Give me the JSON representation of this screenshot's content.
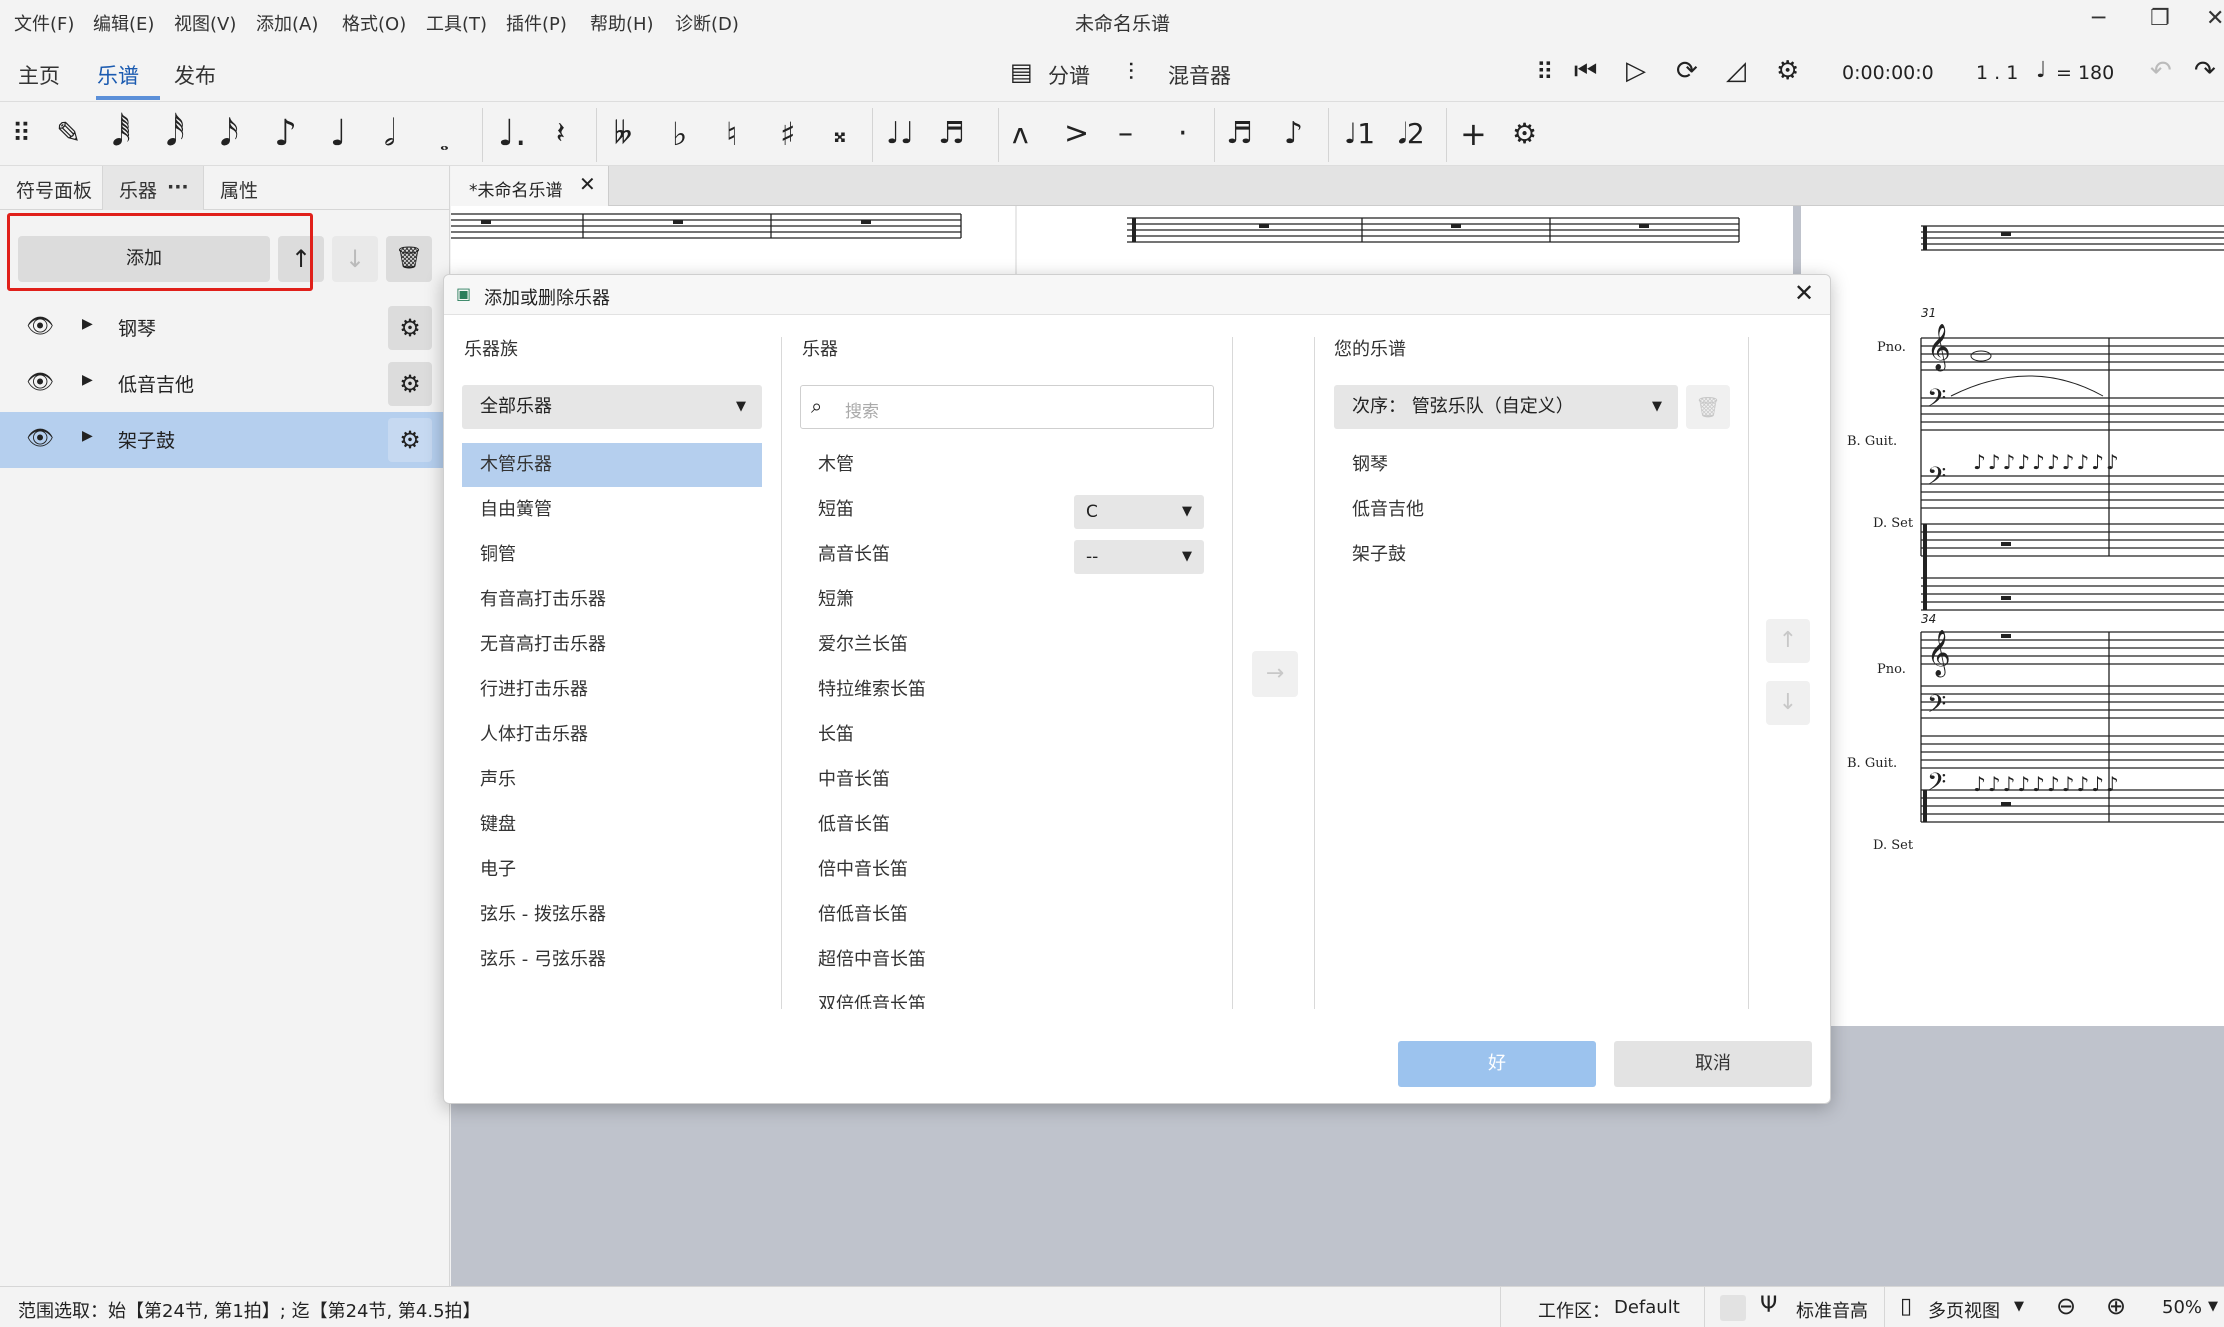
{
  "menubar": {
    "items": [
      "文件(F)",
      "编辑(E)",
      "视图(V)",
      "添加(A)",
      "格式(O)",
      "工具(T)",
      "插件(P)",
      "帮助(H)",
      "诊断(D)"
    ],
    "title": "未命名乐谱"
  },
  "nav": {
    "tabs": [
      "主页",
      "乐谱",
      "发布"
    ],
    "parts_label": "分谱",
    "mixer_label": "混音器",
    "time": "0:00:00:0",
    "position": "1 . 1",
    "tempo": "= 180"
  },
  "left_panel": {
    "tabs": [
      "符号面板",
      "乐器",
      "属性"
    ],
    "more": "···",
    "add_label": "添加",
    "instruments": [
      "钢琴",
      "低音吉他",
      "架子鼓"
    ],
    "selected_index": 2
  },
  "document": {
    "tab_label": "*未命名乐谱"
  },
  "score": {
    "measure_numbers": [
      "31",
      "34"
    ],
    "staff_labels": [
      "Pno.",
      "B. Guit.",
      "D. Set"
    ]
  },
  "dialog": {
    "title": "添加或删除乐器",
    "families_heading": "乐器族",
    "families_combo": "全部乐器",
    "families": [
      "木管乐器",
      "自由簧管",
      "铜管",
      "有音高打击乐器",
      "无音高打击乐器",
      "行进打击乐器",
      "人体打击乐器",
      "声乐",
      "键盘",
      "电子",
      "弦乐 - 拨弦乐器",
      "弦乐 - 弓弦乐器"
    ],
    "families_selected": 0,
    "instruments_heading": "乐器",
    "search_placeholder": "搜索",
    "instruments": [
      "木管",
      "短笛",
      "高音长笛",
      "短箫",
      "爱尔兰长笛",
      "特拉维索长笛",
      "长笛",
      "中音长笛",
      "低音长笛",
      "倍中音长笛",
      "倍低音长笛",
      "超倍中音长笛",
      "双倍低音长笛"
    ],
    "piccolo_key": "C",
    "treble_flute_key": "--",
    "score_heading": "您的乐谱",
    "order_combo": "次序：  管弦乐队（自定义）",
    "score_instruments": [
      "钢琴",
      "低音吉他",
      "架子鼓"
    ],
    "ok_label": "好",
    "cancel_label": "取消"
  },
  "status": {
    "selection": "范围选取：始【第24节, 第1拍】; 迄【第24节, 第4.5拍】",
    "workspace_label": "工作区：",
    "workspace_value": "Default",
    "concert_pitch": "标准音高",
    "view_mode": "多页视图",
    "zoom": "50%"
  },
  "colors": {
    "accent": "#5b8fd8",
    "selection": "#b5cfee",
    "ok_button": "#9cc3ee",
    "highlight_box": "#e0201a",
    "canvas": "#bfc3cc"
  }
}
